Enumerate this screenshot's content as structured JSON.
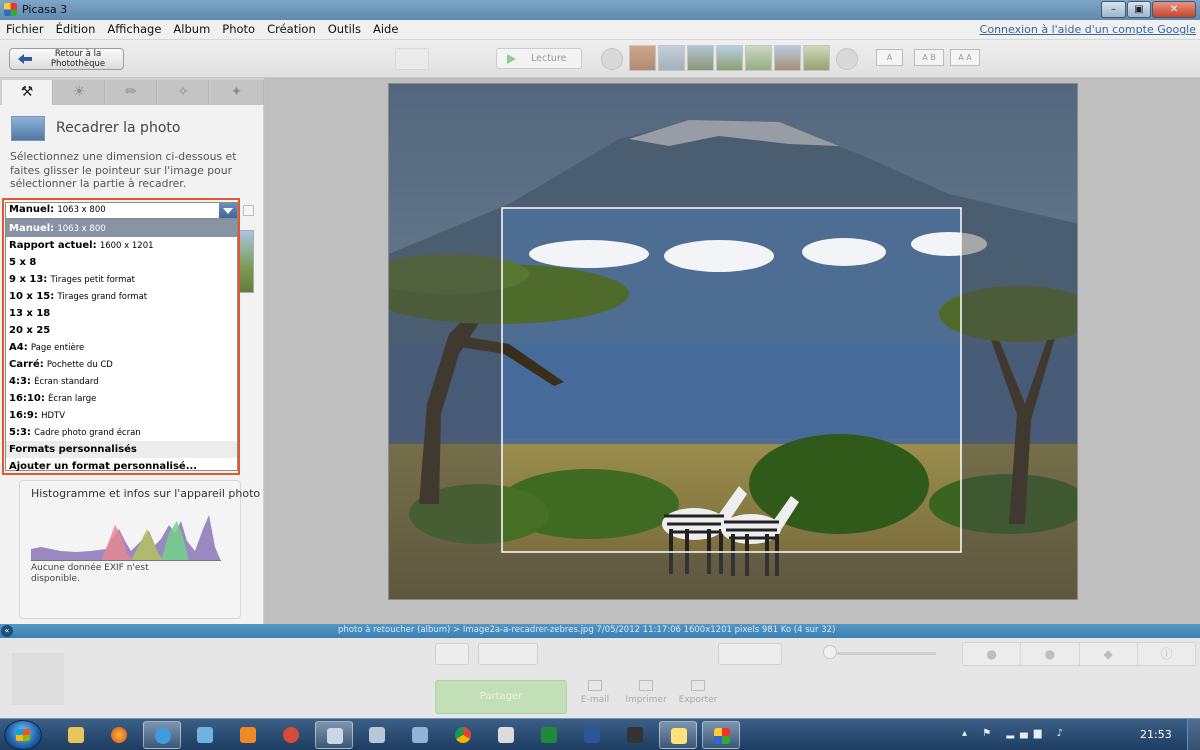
{
  "window": {
    "title": "Picasa 3",
    "minimize": "–",
    "maximize": "▣",
    "close": "✕"
  },
  "menu": {
    "items": [
      "Fichier",
      "Édition",
      "Affichage",
      "Album",
      "Photo",
      "Création",
      "Outils",
      "Aide"
    ],
    "help_link": "Connexion à l'aide d'un compte Google"
  },
  "toolbar": {
    "back_label": "Retour à la Photothèque",
    "lecture_label": "Lecture",
    "caption_buttons": [
      "A",
      "A B",
      "A A"
    ]
  },
  "left_panel": {
    "tabs": [
      "wrench-icon",
      "sun-icon",
      "brush-icon",
      "effects-icon",
      "effects2-icon"
    ],
    "section_title": "Recadrer la photo",
    "instructions": "Sélectionnez une dimension ci-dessous et faites glisser le pointeur sur l'image pour sélectionner la partie à recadrer.",
    "select": {
      "label": "Manuel:",
      "value": "1063 x 800"
    },
    "options": [
      {
        "label": "Manuel:",
        "sub": "1063 x 800",
        "selected": true
      },
      {
        "label": "Rapport actuel:",
        "sub": "1600 x 1201"
      },
      {
        "label": "5 x 8",
        "sub": ""
      },
      {
        "label": "9 x 13:",
        "sub": "Tirages petit format"
      },
      {
        "label": "10 x 15:",
        "sub": "Tirages grand format"
      },
      {
        "label": "13 x 18",
        "sub": ""
      },
      {
        "label": "20 x 25",
        "sub": ""
      },
      {
        "label": "A4:",
        "sub": "Page entière"
      },
      {
        "label": "Carré:",
        "sub": "Pochette du CD"
      },
      {
        "label": "4:3:",
        "sub": "Écran standard"
      },
      {
        "label": "16:10:",
        "sub": "Écran large"
      },
      {
        "label": "16:9:",
        "sub": "HDTV"
      },
      {
        "label": "5:3:",
        "sub": "Cadre photo grand écran"
      },
      {
        "label": "Formats personnalisés",
        "sub": "",
        "group": true
      },
      {
        "label": "Ajouter un format personnalisé...",
        "sub": ""
      }
    ],
    "histogram": {
      "title": "Histogramme et infos sur l'appareil photo",
      "exif_note": "Aucune donnée EXIF n'est disponible."
    }
  },
  "status_bar": {
    "text": "photo à retoucher (album) > Image2a-a-recadrer-zebres.jpg     7/05/2012 11:17:06     1600x1201 pixels     981 Ko     (4 sur 32)"
  },
  "tray": {
    "share_label": "Partager",
    "actions": [
      "E-mail",
      "Imprimer",
      "Exporter"
    ]
  },
  "taskbar": {
    "clock": "21:53",
    "tray_icons": "▴ ⚑ ▂▄▆ ♪"
  },
  "colors": {
    "accent_highlight": "#e4572e",
    "status_bar": "#3b7fb0",
    "share_button": "#c2dfb7"
  }
}
